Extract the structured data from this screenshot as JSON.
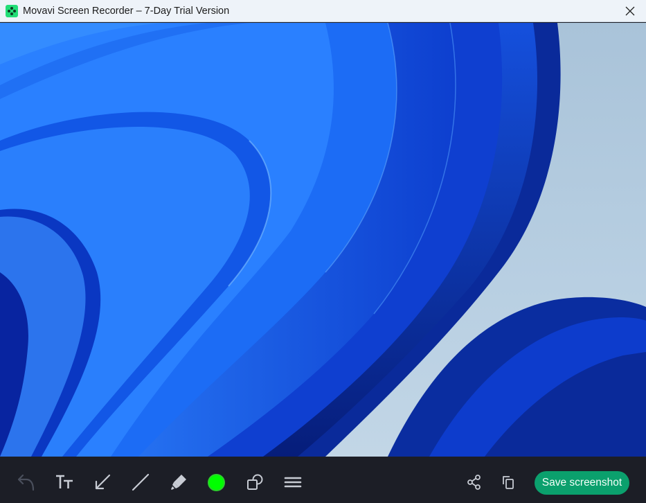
{
  "window": {
    "title": "Movavi Screen Recorder – 7-Day Trial Version",
    "app_icon": "movavi-logo-icon",
    "close_icon": "close-icon"
  },
  "canvas": {
    "content": "Windows 11 blue bloom wallpaper screenshot"
  },
  "toolbar": {
    "tools": [
      {
        "name": "undo",
        "icon": "undo-icon",
        "enabled": false
      },
      {
        "name": "text",
        "icon": "text-size-icon"
      },
      {
        "name": "arrow",
        "icon": "arrow-icon"
      },
      {
        "name": "line",
        "icon": "line-icon"
      },
      {
        "name": "marker",
        "icon": "marker-icon"
      },
      {
        "name": "color",
        "icon": "color-swatch",
        "value": "#00ff00"
      },
      {
        "name": "shapes",
        "icon": "shapes-icon"
      },
      {
        "name": "line-width",
        "icon": "line-width-icon"
      }
    ],
    "share_icon": "share-icon",
    "copy_icon": "copy-icon",
    "save_label": "Save screenshot",
    "accent_color": "#0ba06d"
  }
}
